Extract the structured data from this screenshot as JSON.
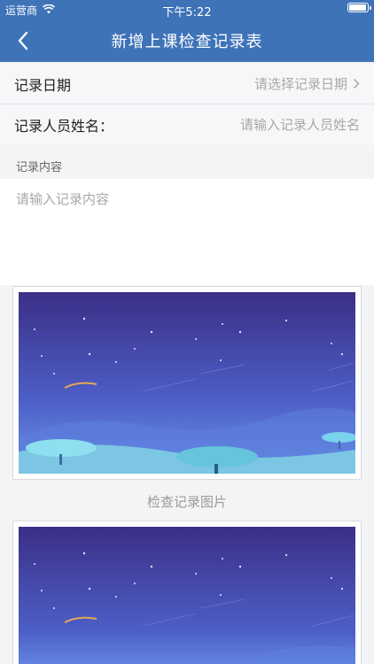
{
  "status_bar": {
    "carrier": "运营商",
    "time": "下午5:22"
  },
  "nav": {
    "title": "新增上课检查记录表",
    "back_icon": "chevron-left-icon"
  },
  "form": {
    "date_label": "记录日期",
    "date_placeholder": "请选择记录日期",
    "name_label": "记录人员姓名：",
    "name_placeholder": "请输入记录人员姓名",
    "content_label": "记录内容",
    "content_placeholder": "请输入记录内容"
  },
  "images": {
    "caption": "检查记录图片"
  },
  "colors": {
    "header_blue": "#3e73b8",
    "sky_top": "#3b2f86",
    "sky_bottom": "#5f86e8",
    "hill": "#7cc6e3"
  }
}
